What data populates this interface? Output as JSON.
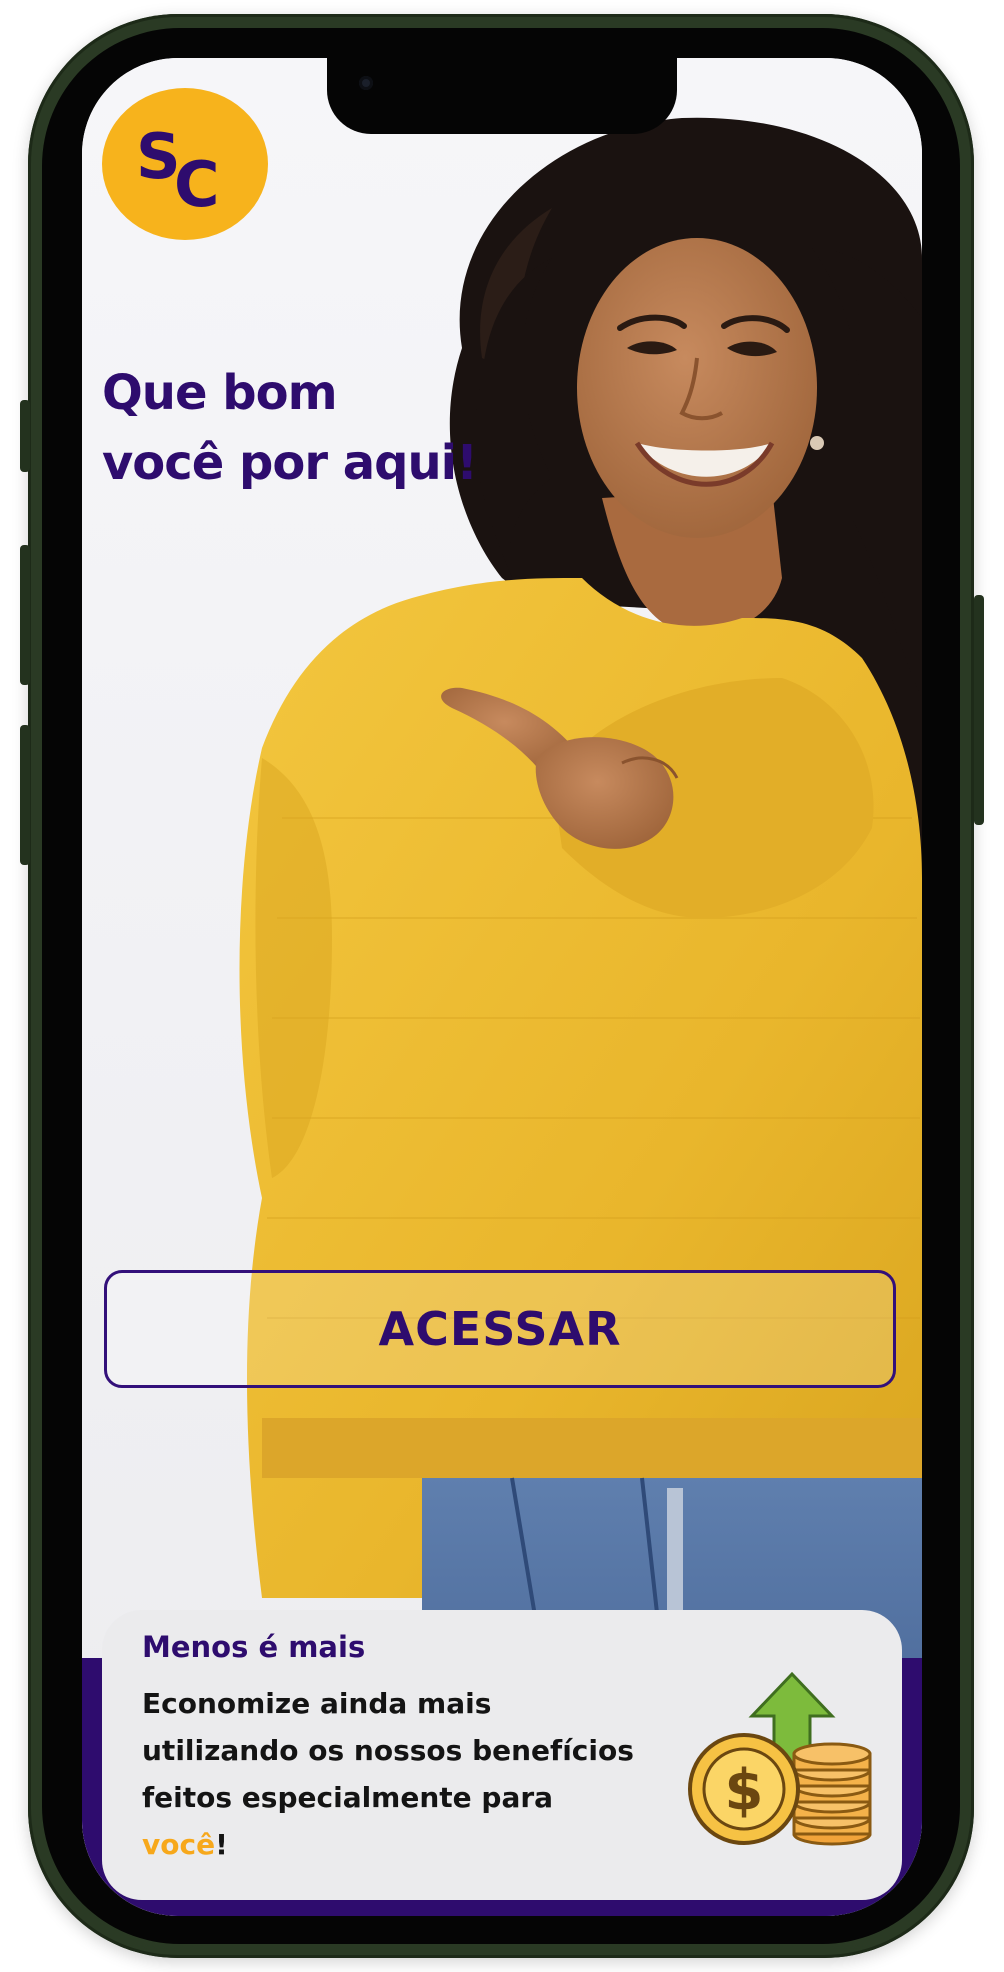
{
  "logo": {
    "text": "SC",
    "color": "#f7b31c",
    "mark_color": "#2e0c6e"
  },
  "headline": {
    "line1": "Que bom",
    "line2": "você por aqui!"
  },
  "cta": {
    "label": "ACESSAR"
  },
  "promo": {
    "kicker": "Menos é mais",
    "line1": "Economize ainda mais",
    "line2": "utilizando os nossos benefícios",
    "line3": "feitos especialmente para",
    "highlight": "você",
    "suffix": "!",
    "icon": "money-coins-growth-icon"
  },
  "colors": {
    "brand_purple": "#2e0c6e",
    "brand_yellow": "#f7b31c",
    "phone_frame": "#2a3a24"
  }
}
